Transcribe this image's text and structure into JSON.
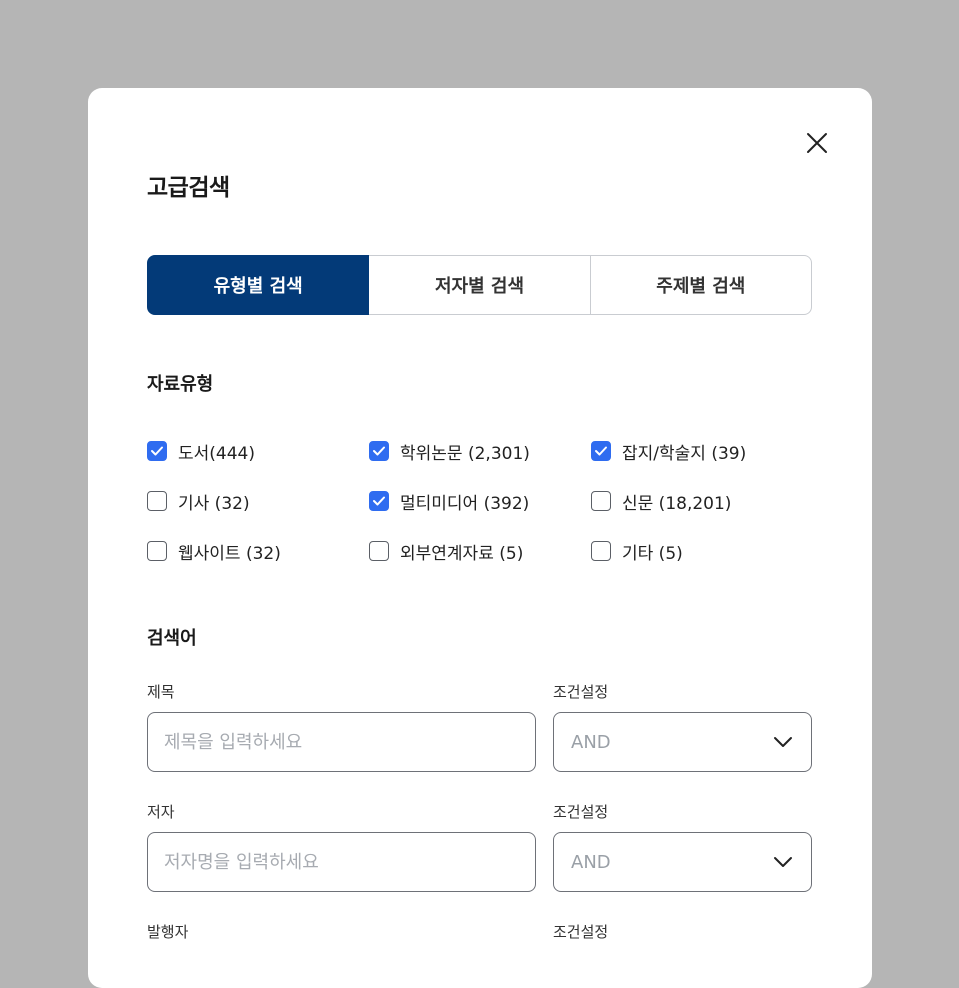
{
  "modal": {
    "title": "고급검색",
    "close_icon": "close-icon"
  },
  "tabs": [
    {
      "label": "유형별 검색",
      "active": true
    },
    {
      "label": "저자별 검색",
      "active": false
    },
    {
      "label": "주제별 검색",
      "active": false
    }
  ],
  "material_types": {
    "heading": "자료유형",
    "items": [
      {
        "label": "도서(444)",
        "checked": true
      },
      {
        "label": "학위논문 (2,301)",
        "checked": true
      },
      {
        "label": "잡지/학술지 (39)",
        "checked": true
      },
      {
        "label": "기사 (32)",
        "checked": false
      },
      {
        "label": "멀티미디어 (392)",
        "checked": true
      },
      {
        "label": "신문 (18,201)",
        "checked": false
      },
      {
        "label": "웹사이트 (32)",
        "checked": false
      },
      {
        "label": "외부연계자료 (5)",
        "checked": false
      },
      {
        "label": "기타 (5)",
        "checked": false
      }
    ]
  },
  "search_terms": {
    "heading": "검색어",
    "fields": [
      {
        "label": "제목",
        "placeholder": "제목을 입력하세요",
        "condition_label": "조건설정",
        "condition_value": "AND"
      },
      {
        "label": "저자",
        "placeholder": "저자명을 입력하세요",
        "condition_label": "조건설정",
        "condition_value": "AND"
      },
      {
        "label": "발행자",
        "placeholder": "",
        "condition_label": "조건설정",
        "condition_value": ""
      }
    ]
  },
  "colors": {
    "accent": "#033a78",
    "checkbox": "#2f6cf0",
    "backdrop": "#b5b5b5"
  }
}
